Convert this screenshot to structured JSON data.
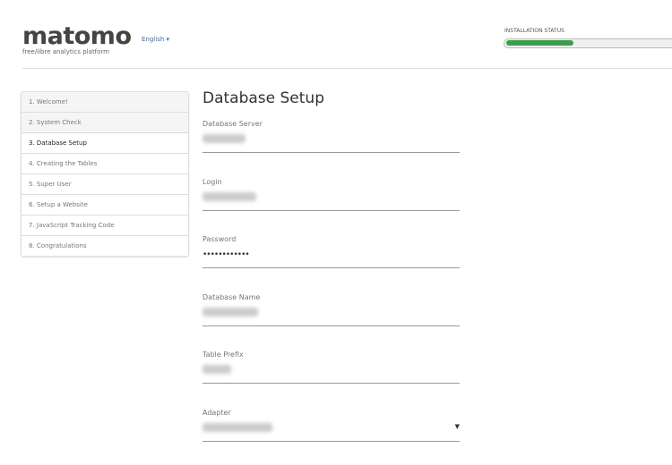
{
  "header": {
    "logo": "matomo",
    "tagline": "free/libre analytics platform",
    "language": "English",
    "language_caret": "▾",
    "installation_status_label": "INSTALLATION STATUS",
    "progress_percent": 37.5,
    "progress_color": "#3a9f48"
  },
  "steps": [
    {
      "label": "1. Welcome!",
      "state": "done"
    },
    {
      "label": "2. System Check",
      "state": "done"
    },
    {
      "label": "3. Database Setup",
      "state": "current"
    },
    {
      "label": "4. Creating the Tables",
      "state": "todo"
    },
    {
      "label": "5. Super User",
      "state": "todo"
    },
    {
      "label": "6. Setup a Website",
      "state": "todo"
    },
    {
      "label": "7. JavaScript Tracking Code",
      "state": "todo"
    },
    {
      "label": "8. Congratulations",
      "state": "todo"
    }
  ],
  "form": {
    "title": "Database Setup",
    "database_server": {
      "label": "Database Server"
    },
    "login": {
      "label": "Login"
    },
    "password": {
      "label": "Password",
      "value": "••••••••••••"
    },
    "database_name": {
      "label": "Database Name"
    },
    "table_prefix": {
      "label": "Table Prefix"
    },
    "adapter": {
      "label": "Adapter",
      "caret": "▼"
    }
  }
}
